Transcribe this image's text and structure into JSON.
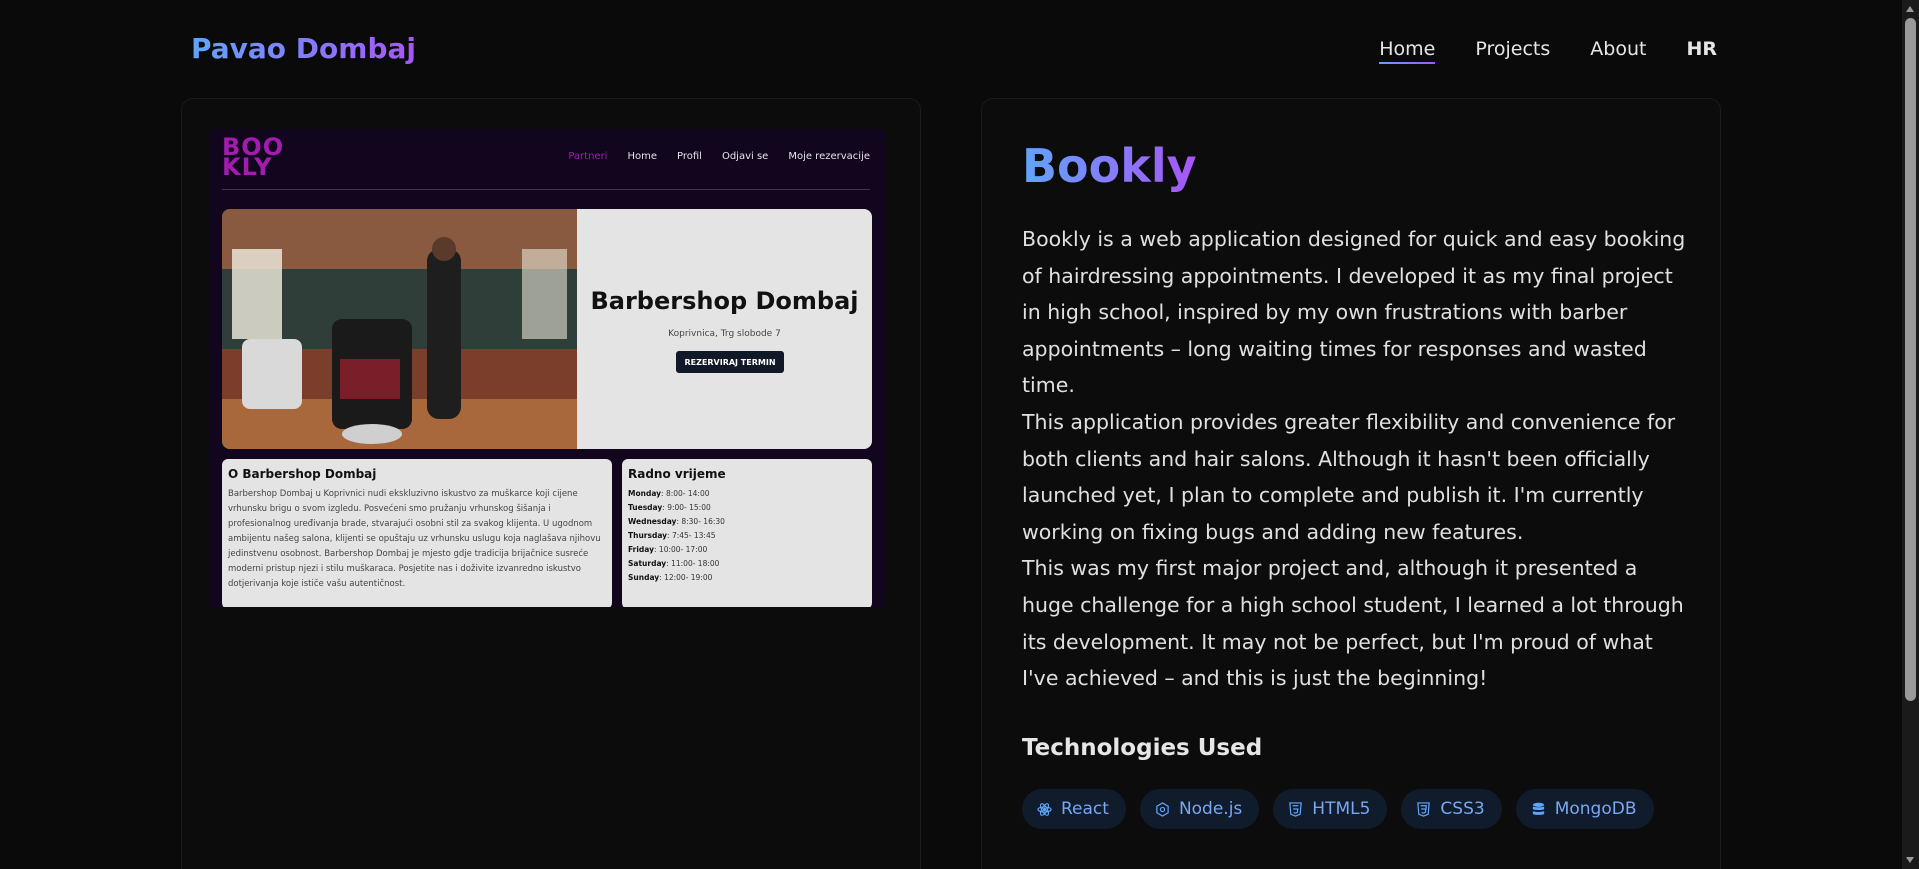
{
  "header": {
    "logo": "Pavao Dombaj",
    "nav": [
      {
        "label": "Home",
        "active": true
      },
      {
        "label": "Projects",
        "active": false
      },
      {
        "label": "About",
        "active": false
      },
      {
        "label": "HR",
        "active": false
      }
    ]
  },
  "preview": {
    "logo": "BOO KLY",
    "nav": [
      "Partneri",
      "Home",
      "Profil",
      "Odjavi se",
      "Moje rezervacije"
    ],
    "hero_title": "Barbershop Dombaj",
    "hero_sub": "Koprivnica, Trg slobode 7",
    "hero_button": "REZERVIRAJ TERMIN",
    "about_title": "O Barbershop Dombaj",
    "about_text": "Barbershop Dombaj u Koprivnici nudi ekskluzivno iskustvo za muškarce koji cijene vrhunsku brigu o svom izgledu. Posvećeni smo pružanju vrhunskog šišanja i profesionalnog uređivanja brade, stvarajući osobni stil za svakog klijenta. U ugodnom ambijentu našeg salona, klijenti se opuštaju uz vrhunsku uslugu koja naglašava njihovu jedinstvenu osobnost. Barbershop Dombaj je mjesto gdje tradicija brijačnice susreće moderni pristup njezi i stilu muškaraca. Posjetite nas i doživite izvanredno iskustvo dotjerivanja koje ističe vašu autentičnost.",
    "hours_title": "Radno vrijeme",
    "hours": [
      {
        "day": "Monday",
        "time": ": 8:00- 14:00"
      },
      {
        "day": "Tuesday",
        "time": ": 9:00- 15:00"
      },
      {
        "day": "Wednesday",
        "time": ": 8:30- 16:30"
      },
      {
        "day": "Thursday",
        "time": ": 7:45- 13:45"
      },
      {
        "day": "Friday",
        "time": ": 10:00- 17:00"
      },
      {
        "day": "Saturday",
        "time": ": 11:00- 18:00"
      },
      {
        "day": "Sunday",
        "time": ": 12:00- 19:00"
      }
    ]
  },
  "project": {
    "title": "Bookly",
    "paragraphs": [
      "Bookly is a web application designed for quick and easy booking of hairdressing appointments. I developed it as my final project in high school, inspired by my own frustrations with barber appointments – long waiting times for responses and wasted time.",
      "This application provides greater flexibility and convenience for both clients and hair salons. Although it hasn't been officially launched yet, I plan to complete and publish it. I'm currently working on fixing bugs and adding new features.",
      "This was my first major project and, although it presented a huge challenge for a high school student, I learned a lot through its development. It may not be perfect, but I'm proud of what I've achieved – and this is just the beginning!"
    ],
    "tech_title": "Technologies Used",
    "technologies": [
      {
        "label": "React",
        "icon": "react-icon"
      },
      {
        "label": "Node.js",
        "icon": "nodejs-icon"
      },
      {
        "label": "HTML5",
        "icon": "html5-icon"
      },
      {
        "label": "CSS3",
        "icon": "css3-icon"
      },
      {
        "label": "MongoDB",
        "icon": "database-icon"
      }
    ]
  },
  "colors": {
    "background": "#0a0a0a",
    "gradient_start": "#60a5fa",
    "gradient_end": "#a855f7",
    "tag_bg": "#101b2c",
    "tag_text": "#7aa7f2"
  }
}
